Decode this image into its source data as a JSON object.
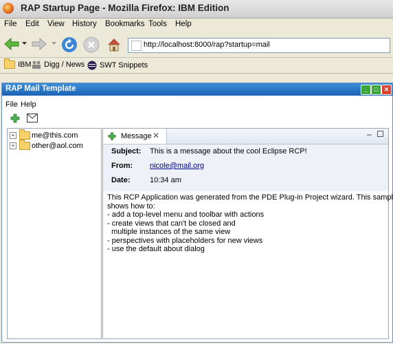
{
  "browser": {
    "window_title": "RAP Startup Page - Mozilla Firefox: IBM Edition",
    "menu": [
      "File",
      "Edit",
      "View",
      "History",
      "Bookmarks",
      "Tools",
      "Help"
    ],
    "nav_icons": [
      "back-icon",
      "forward-icon",
      "reload-icon",
      "stop-icon",
      "home-icon"
    ],
    "url": "http://localhost:8000/rap?startup=mail",
    "bookmarks": [
      {
        "label": "IBM",
        "icon": "folder-icon"
      },
      {
        "label": "Digg / News",
        "icon": "people-icon"
      },
      {
        "label": "SWT Snippets",
        "icon": "eclipse-icon"
      }
    ]
  },
  "app": {
    "title": "RAP Mail Template",
    "menu": [
      "File",
      "Help"
    ],
    "toolbar_icons": [
      "open-view-icon",
      "open-message-icon"
    ],
    "tree": [
      {
        "label": "me@this.com"
      },
      {
        "label": "other@aol.com"
      }
    ],
    "message_view": {
      "tab_label": "Message",
      "subject_label": "Subject:",
      "subject": "This is a message about the cool Eclipse RCP!",
      "from_label": "From:",
      "from": "nicole@mail.org",
      "date_label": "Date:",
      "date": "10:34 am",
      "body": [
        "This RCP Application was generated from the PDE Plug-in Project wizard. This sample",
        "shows how to:",
        "- add a top-level menu and toolbar with actions",
        "- create views that can't be closed and",
        "  multiple instances of the same view",
        "- perspectives with placeholders for new views",
        "- use the default about dialog"
      ]
    }
  },
  "colors": {
    "rap_title_bar": "#1c62b4",
    "link": "#00008b"
  }
}
